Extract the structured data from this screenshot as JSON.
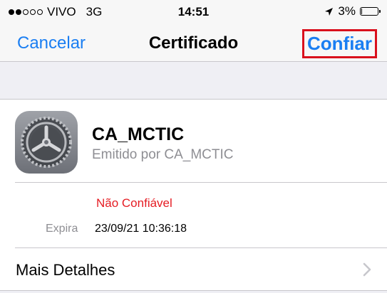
{
  "status_bar": {
    "carrier": "VIVO",
    "network": "3G",
    "time": "14:51",
    "battery_percent": "3%",
    "signal_bars_filled": 2,
    "signal_bars_total": 5,
    "battery_level": 0.03
  },
  "nav": {
    "cancel_label": "Cancelar",
    "title": "Certificado",
    "trust_label": "Confiar"
  },
  "certificate": {
    "name": "CA_MCTIC",
    "issuer": "Emitido por CA_MCTIC",
    "icon": "settings-gear-icon",
    "trust_status": "Não Confiável",
    "expire_label": "Expira",
    "expire_value": "23/09/21 10:36:18"
  },
  "details": {
    "label": "Mais Detalhes"
  },
  "colors": {
    "accent": "#1a7ef2",
    "danger": "#e51c23",
    "highlight_border": "#d9101d",
    "secondary_text": "#8e8e93"
  }
}
